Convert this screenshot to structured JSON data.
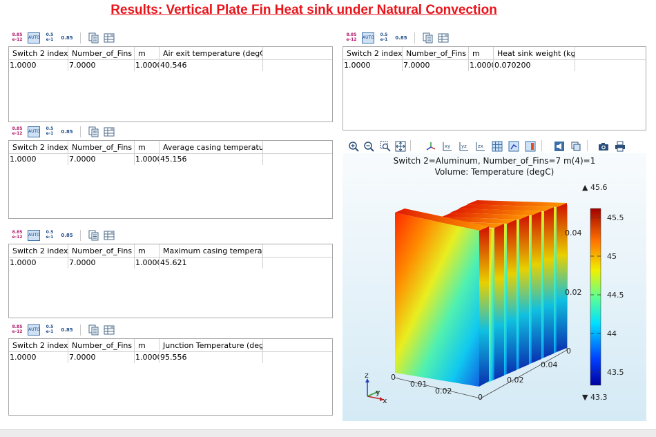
{
  "title": "Results: Vertical Plate Fin Heat sink under Natural Convection",
  "toolbar": {
    "fmt_top": "8.85",
    "fmt_bottom": "e-12",
    "auto_label": "AUTO",
    "e1_top": "0.5",
    "e1_bottom": "e-1",
    "precision_label": "0.85"
  },
  "tables": [
    {
      "columns": [
        "Switch 2 index",
        "Number_of_Fins",
        "m",
        "Air exit temperature (degC)"
      ],
      "rows": [
        [
          "1.0000",
          "7.0000",
          "1.0000",
          "40.546"
        ]
      ]
    },
    {
      "columns": [
        "Switch 2 index",
        "Number_of_Fins",
        "m",
        "Average casing temperature (degC)"
      ],
      "rows": [
        [
          "1.0000",
          "7.0000",
          "1.0000",
          "45.156"
        ]
      ]
    },
    {
      "columns": [
        "Switch 2 index",
        "Number_of_Fins",
        "m",
        "Maximum casing temperature (degC)"
      ],
      "rows": [
        [
          "1.0000",
          "7.0000",
          "1.0000",
          "45.621"
        ]
      ]
    },
    {
      "columns": [
        "Switch 2 index",
        "Number_of_Fins",
        "m",
        "Junction Temperature (degC)"
      ],
      "rows": [
        [
          "1.0000",
          "7.0000",
          "1.0000",
          "95.556"
        ]
      ]
    },
    {
      "columns": [
        "Switch 2 index",
        "Number_of_Fins",
        "m",
        "Heat sink weight (kg)"
      ],
      "rows": [
        [
          "1.0000",
          "7.0000",
          "1.0000",
          "0.070200"
        ]
      ]
    }
  ],
  "plot": {
    "title_line1": "Switch 2=Aluminum, Number_of_Fins=7 m(4)=1",
    "title_line2": "Volume: Temperature (degC)",
    "max_label": "▲ 45.6",
    "min_label": "▼ 43.3",
    "colorbar_ticks": [
      "45.5",
      "45",
      "44.5",
      "44",
      "43.5"
    ],
    "axis_ticks": {
      "z": [
        "0.04",
        "0.02",
        "0"
      ],
      "x": [
        "0",
        "0.01",
        "0.02"
      ],
      "y": [
        "0.04",
        "0.02",
        "0"
      ]
    },
    "triad": {
      "z": "z",
      "y": "y",
      "x": "x"
    }
  }
}
